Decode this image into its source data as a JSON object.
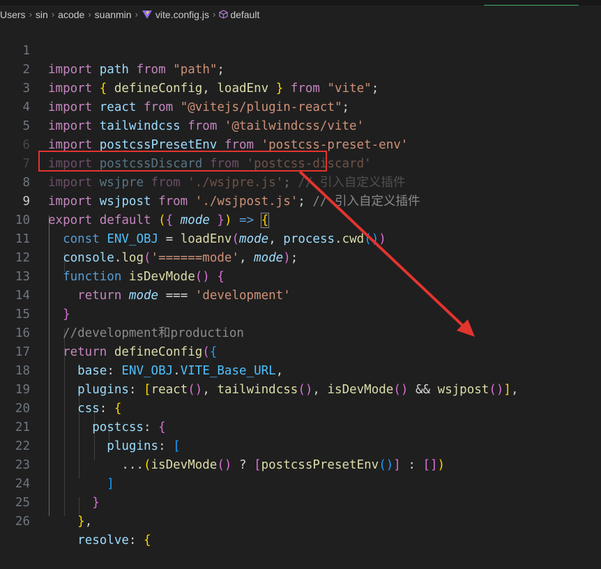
{
  "breadcrumb": {
    "parts": [
      "Users",
      "sin",
      "acode",
      "suanmin"
    ],
    "file": "vite.config.js",
    "symbol": "default"
  },
  "editor": {
    "active_line": 9,
    "lines": [
      {
        "n": "1"
      },
      {
        "n": "2"
      },
      {
        "n": "3"
      },
      {
        "n": "4"
      },
      {
        "n": "5"
      },
      {
        "n": "6"
      },
      {
        "n": "7"
      },
      {
        "n": "8"
      },
      {
        "n": "9"
      },
      {
        "n": "10"
      },
      {
        "n": "11"
      },
      {
        "n": "12"
      },
      {
        "n": "13"
      },
      {
        "n": "14"
      },
      {
        "n": "15"
      },
      {
        "n": "16"
      },
      {
        "n": "17"
      },
      {
        "n": "18"
      },
      {
        "n": "19"
      },
      {
        "n": "20"
      },
      {
        "n": "21"
      },
      {
        "n": "22"
      },
      {
        "n": "23"
      },
      {
        "n": "24"
      },
      {
        "n": "25"
      },
      {
        "n": "26"
      }
    ],
    "tokens": {
      "import": "import",
      "from": "from",
      "export": "export",
      "default": "default",
      "const": "const",
      "function": "function",
      "return": "return",
      "l1_path": "path",
      "l1_src": "\"path\"",
      "l2_defineConfig": "defineConfig",
      "l2_loadEnv": "loadEnv",
      "l2_src": "\"vite\"",
      "l3_react": "react",
      "l3_src": "\"@vitejs/plugin-react\"",
      "l4_tailwindcss": "tailwindcss",
      "l4_src": "'@tailwindcss/vite'",
      "l5_postcssPresetEnv": "postcssPresetEnv",
      "l5_src": "'postcss-preset-env'",
      "l6_postcssDiscard": "postcssDiscard",
      "l6_src": "'postcss-discard'",
      "l7_wsjpre": "wsjpre",
      "l7_src": "'./wsjpre.js'",
      "l7_comment": "// 引入自定义插件",
      "l8_wsjpost": "wsjpost",
      "l8_src": "'./wsjpost.js'",
      "l8_comment": "// 引入自定义插件",
      "mode": "mode",
      "l10_env": "ENV_OBJ",
      "l10_loadEnv": "loadEnv",
      "l10_process": "process",
      "l10_cwd": "cwd",
      "l11_console": "console",
      "l11_log": "log",
      "l11_str": "'======mode'",
      "l12_isDevMode": "isDevMode",
      "l13_str": "'development'",
      "l15_comment": "//development和production",
      "l16_defineConfig": "defineConfig",
      "l17_base": "base",
      "l17_env": "ENV_OBJ",
      "l17_prop": "VITE_Base_URL",
      "l18_plugins": "plugins",
      "l18_react": "react",
      "l18_tailwind": "tailwindcss",
      "l18_isDev": "isDevMode",
      "l18_wsjpost": "wsjpost",
      "l19_css": "css",
      "l20_postcss": "postcss",
      "l21_plugins": "plugins",
      "l22_isDev": "isDevMode",
      "l22_preset": "postcssPresetEnv",
      "l26_resolve": "resolve"
    }
  },
  "colors": {
    "background": "#1f1f1f",
    "keyword": "#569cd6",
    "control": "#c586c0",
    "function": "#dcdcaa",
    "variable": "#9cdcfe",
    "string": "#ce9178",
    "comment": "#8a8a8a",
    "annotation": "#e3342f"
  }
}
